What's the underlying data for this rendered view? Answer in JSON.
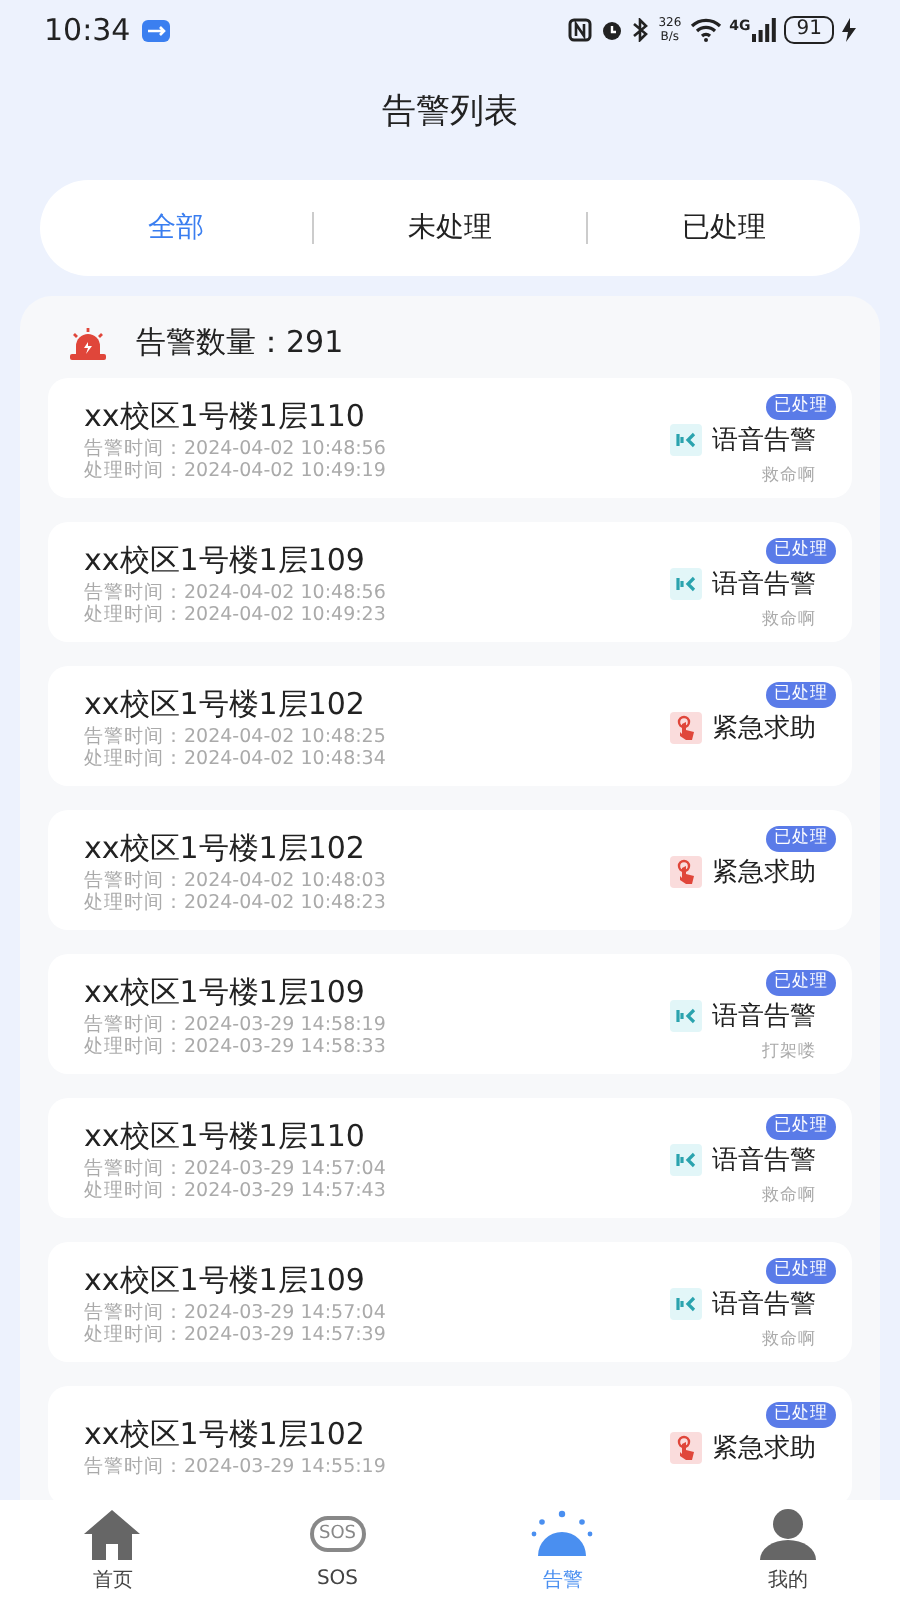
{
  "status_bar": {
    "time": "10:34",
    "speed": "326",
    "speed_unit": "B/s",
    "network": "4G",
    "battery": "91"
  },
  "title": "告警列表",
  "tabs": [
    {
      "label": "全部",
      "selected": true
    },
    {
      "label": "未处理",
      "selected": false
    },
    {
      "label": "已处理",
      "selected": false
    }
  ],
  "summary": {
    "label": "告警数量：291"
  },
  "alarms": [
    {
      "location": "xx校区1号楼1层110",
      "alarm_time": "告警时间：2024-04-02 10:48:56",
      "handled_time": "处理时间：2024-04-02 10:49:19",
      "status": "已处理",
      "kind": "voice",
      "type": "语音告警",
      "note": "救命啊"
    },
    {
      "location": "xx校区1号楼1层109",
      "alarm_time": "告警时间：2024-04-02 10:48:56",
      "handled_time": "处理时间：2024-04-02 10:49:23",
      "status": "已处理",
      "kind": "voice",
      "type": "语音告警",
      "note": "救命啊"
    },
    {
      "location": "xx校区1号楼1层102",
      "alarm_time": "告警时间：2024-04-02 10:48:25",
      "handled_time": "处理时间：2024-04-02 10:48:34",
      "status": "已处理",
      "kind": "sos",
      "type": "紧急求助"
    },
    {
      "location": "xx校区1号楼1层102",
      "alarm_time": "告警时间：2024-04-02 10:48:03",
      "handled_time": "处理时间：2024-04-02 10:48:23",
      "status": "已处理",
      "kind": "sos",
      "type": "紧急求助"
    },
    {
      "location": "xx校区1号楼1层109",
      "alarm_time": "告警时间：2024-03-29 14:58:19",
      "handled_time": "处理时间：2024-03-29 14:58:33",
      "status": "已处理",
      "kind": "voice",
      "type": "语音告警",
      "note": "打架喽"
    },
    {
      "location": "xx校区1号楼1层110",
      "alarm_time": "告警时间：2024-03-29 14:57:04",
      "handled_time": "处理时间：2024-03-29 14:57:43",
      "status": "已处理",
      "kind": "voice",
      "type": "语音告警",
      "note": "救命啊"
    },
    {
      "location": "xx校区1号楼1层109",
      "alarm_time": "告警时间：2024-03-29 14:57:04",
      "handled_time": "处理时间：2024-03-29 14:57:39",
      "status": "已处理",
      "kind": "voice",
      "type": "语音告警",
      "note": "救命啊"
    },
    {
      "location": "xx校区1号楼1层102",
      "alarm_time": "告警时间：2024-03-29 14:55:19",
      "status": "已处理",
      "kind": "sos",
      "type": "紧急求助"
    }
  ],
  "nav": [
    {
      "label": "首页",
      "kind": "home",
      "selected": false
    },
    {
      "label": "SOS",
      "kind": "sos",
      "icon_text": "SOS",
      "selected": false
    },
    {
      "label": "告警",
      "kind": "alarm",
      "selected": true
    },
    {
      "label": "我的",
      "kind": "user",
      "selected": false
    }
  ]
}
